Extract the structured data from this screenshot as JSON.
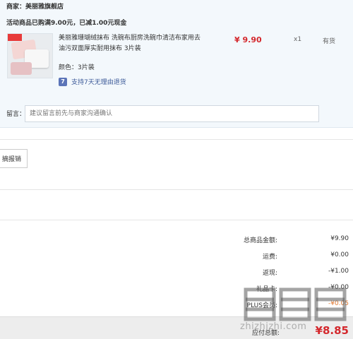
{
  "order": {
    "merchant": "商家：美丽雅旗舰店",
    "promo": "活动商品已购满9.00元，已减1.00元现金",
    "product": {
      "title": "美丽雅珊瑚绒抹布 洗碗布厨房洗碗巾清洁布家用去油污双面厚实耐用抹布 3片装",
      "color": "颜色：3片装",
      "guarantee_icon": "7",
      "guarantee": "支持7天无理由退货",
      "price": "¥ 9.90",
      "qty": "x1",
      "stock": "有货"
    },
    "message": {
      "label": "留言：",
      "placeholder": "建议留言前先与商家沟通确认"
    }
  },
  "invoice": {
    "button_label": "摘报销"
  },
  "summary": {
    "rows": [
      {
        "label": "总商品金额:",
        "value": "¥9.90"
      },
      {
        "label": "运费:",
        "value": "¥0.00"
      },
      {
        "label": "返现:",
        "value": "-¥1.00"
      },
      {
        "label": "礼品卡:",
        "value": "-¥0.00"
      },
      {
        "label": "PLUS会员:",
        "value": "-¥0.05"
      }
    ],
    "total_label": "应付总额:",
    "total_value": "¥8.85"
  },
  "watermark": {
    "text": "zhizhizhi.com",
    "glyph": "值值值"
  },
  "colors": {
    "price_red": "#d4282d",
    "card_bg": "#f3f8fc",
    "guarantee_blue": "#3b5998"
  }
}
